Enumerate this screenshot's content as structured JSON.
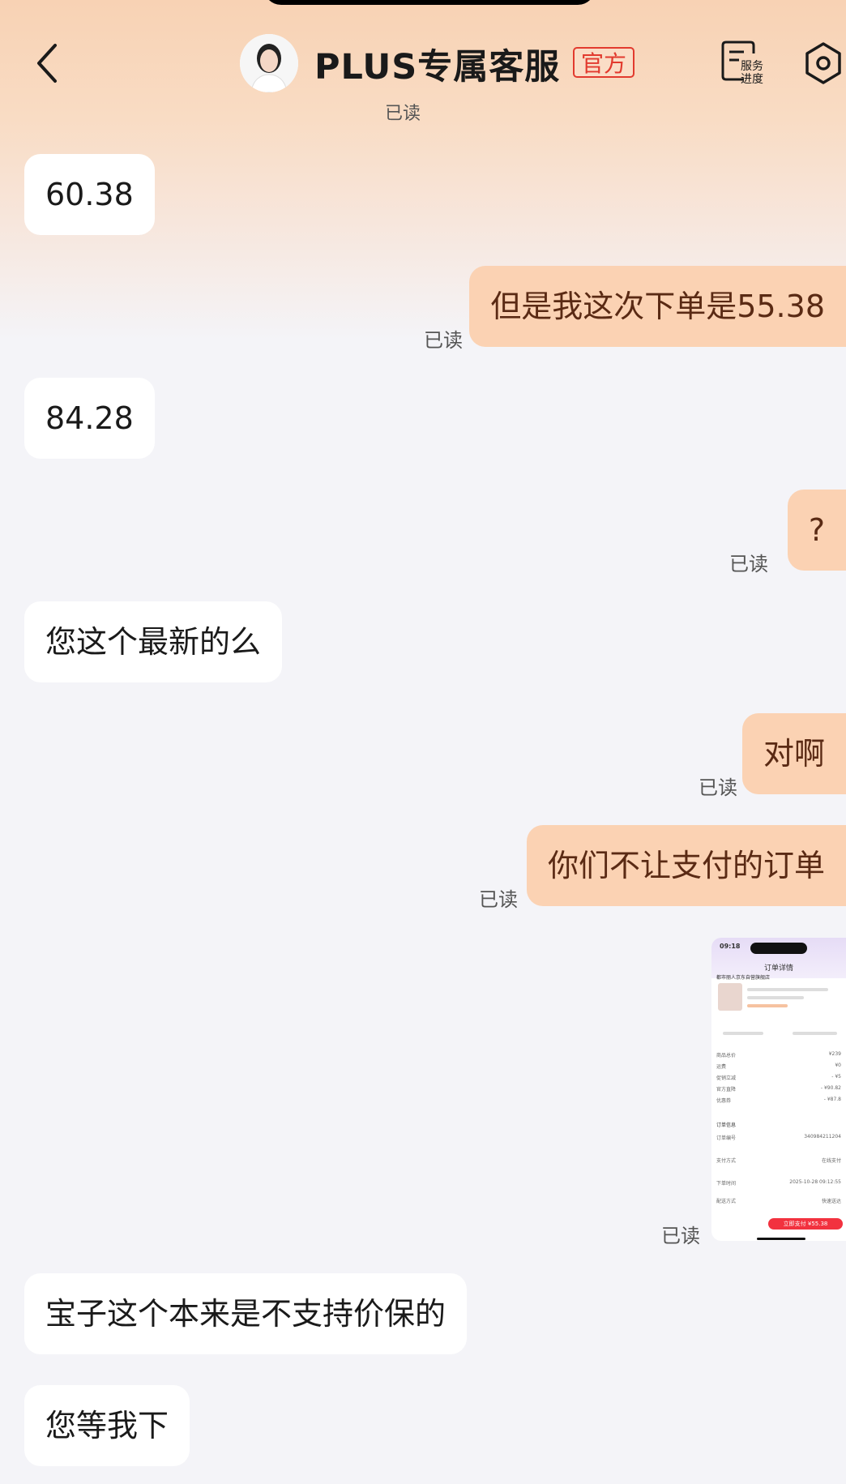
{
  "header": {
    "title": "PLUS专属客服",
    "badge": "官方",
    "progress_label_line1": "服务",
    "progress_label_line2": "进度"
  },
  "messages": [
    {
      "side": "left",
      "text": "60.38"
    },
    {
      "side": "right",
      "text": "但是我这次下单是55.38",
      "status": "已读"
    },
    {
      "side": "left",
      "text": "84.28"
    },
    {
      "side": "right",
      "text": "?",
      "status": "已读"
    },
    {
      "side": "left",
      "text": "您这个最新的么"
    },
    {
      "side": "right",
      "text": "对啊",
      "status": "已读"
    },
    {
      "side": "right",
      "text": "你们不让支付的订单",
      "status": "已读"
    },
    {
      "side": "right",
      "type": "image",
      "status": "已读"
    },
    {
      "side": "left",
      "text": "宝子这个本来是不支持价保的"
    },
    {
      "side": "left",
      "text": "您等我下"
    }
  ],
  "read_top": "已读",
  "thumbnail": {
    "time": "09:18",
    "title": "订单详情",
    "shop": "都市丽人京东自营旗舰店",
    "rows": [
      [
        "商品总价",
        "¥239"
      ],
      [
        "运费",
        "¥0"
      ],
      [
        "促销立减",
        "- ¥5"
      ],
      [
        "官方直降",
        "- ¥90.82"
      ],
      [
        "优惠券",
        "- ¥87.8"
      ],
      [
        "订单信息",
        ""
      ],
      [
        "订单编号",
        "340984211204"
      ],
      [
        "支付方式",
        "在线支付"
      ],
      [
        "下单时间",
        "2025-10-28 09:12:55"
      ],
      [
        "配送方式",
        "快速送达"
      ]
    ],
    "pay_label": "立即支付 ¥55.38"
  }
}
